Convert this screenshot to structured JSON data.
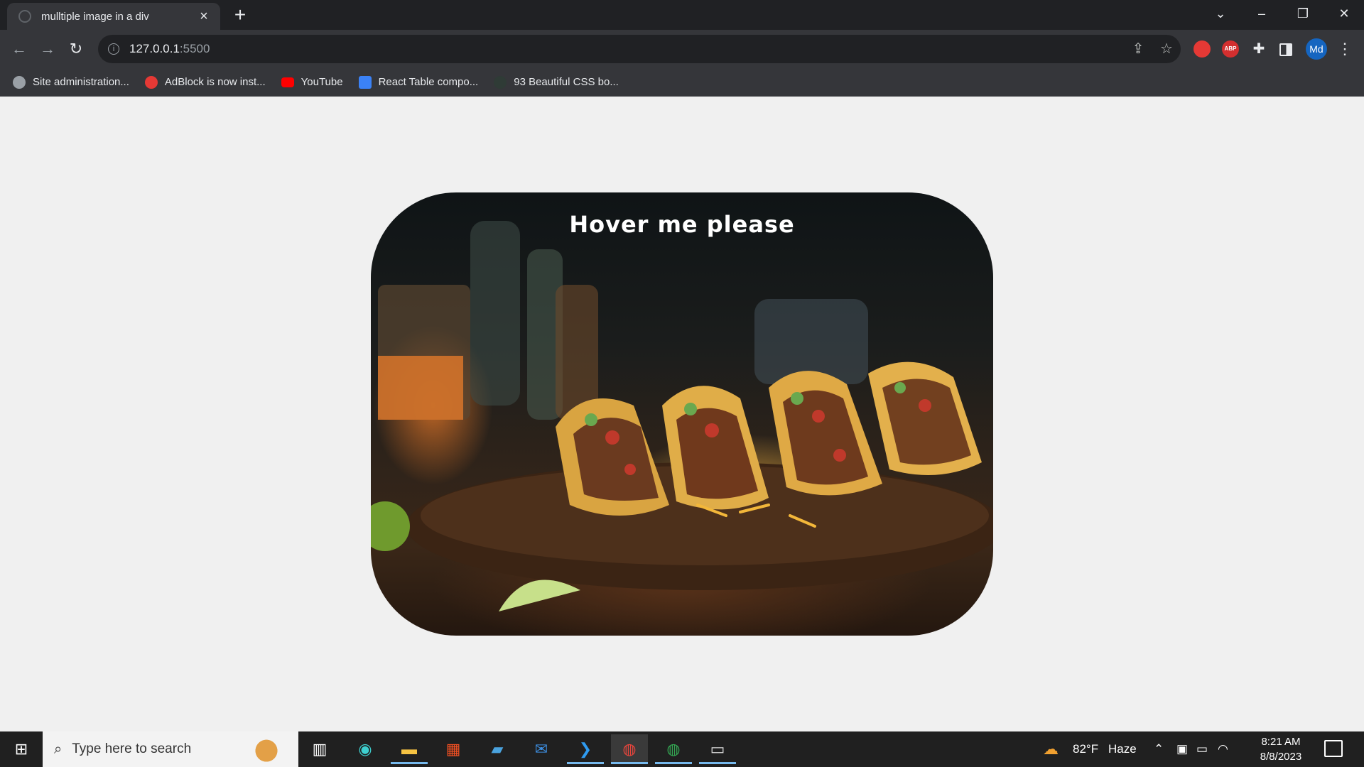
{
  "browser": {
    "tab_title": "mulltiple image in a div",
    "new_tab": "+",
    "url_host": "127.0.0.1",
    "url_port": ":5500",
    "profile_initials": "Md",
    "bookmarks": [
      {
        "label": "Site administration...",
        "icon": "site-icon"
      },
      {
        "label": "AdBlock is now inst...",
        "icon": "adblock-icon"
      },
      {
        "label": "YouTube",
        "icon": "youtube-icon"
      },
      {
        "label": "React Table compo...",
        "icon": "react-table-icon"
      },
      {
        "label": "93 Beautiful CSS bo...",
        "icon": "css-icon"
      }
    ]
  },
  "page": {
    "card_text": "Hover me please",
    "card_image": "tacos on wooden board"
  },
  "taskbar": {
    "search_placeholder": "Type here to search",
    "weather_temp": "82°F",
    "weather_desc": "Haze",
    "time": "8:21 AM",
    "date": "8/8/2023"
  },
  "colors": {
    "chrome_dark": "#202124",
    "chrome_toolbar": "#35363a",
    "page_bg": "#f0f0f0",
    "taskbar_bg": "#202020"
  }
}
